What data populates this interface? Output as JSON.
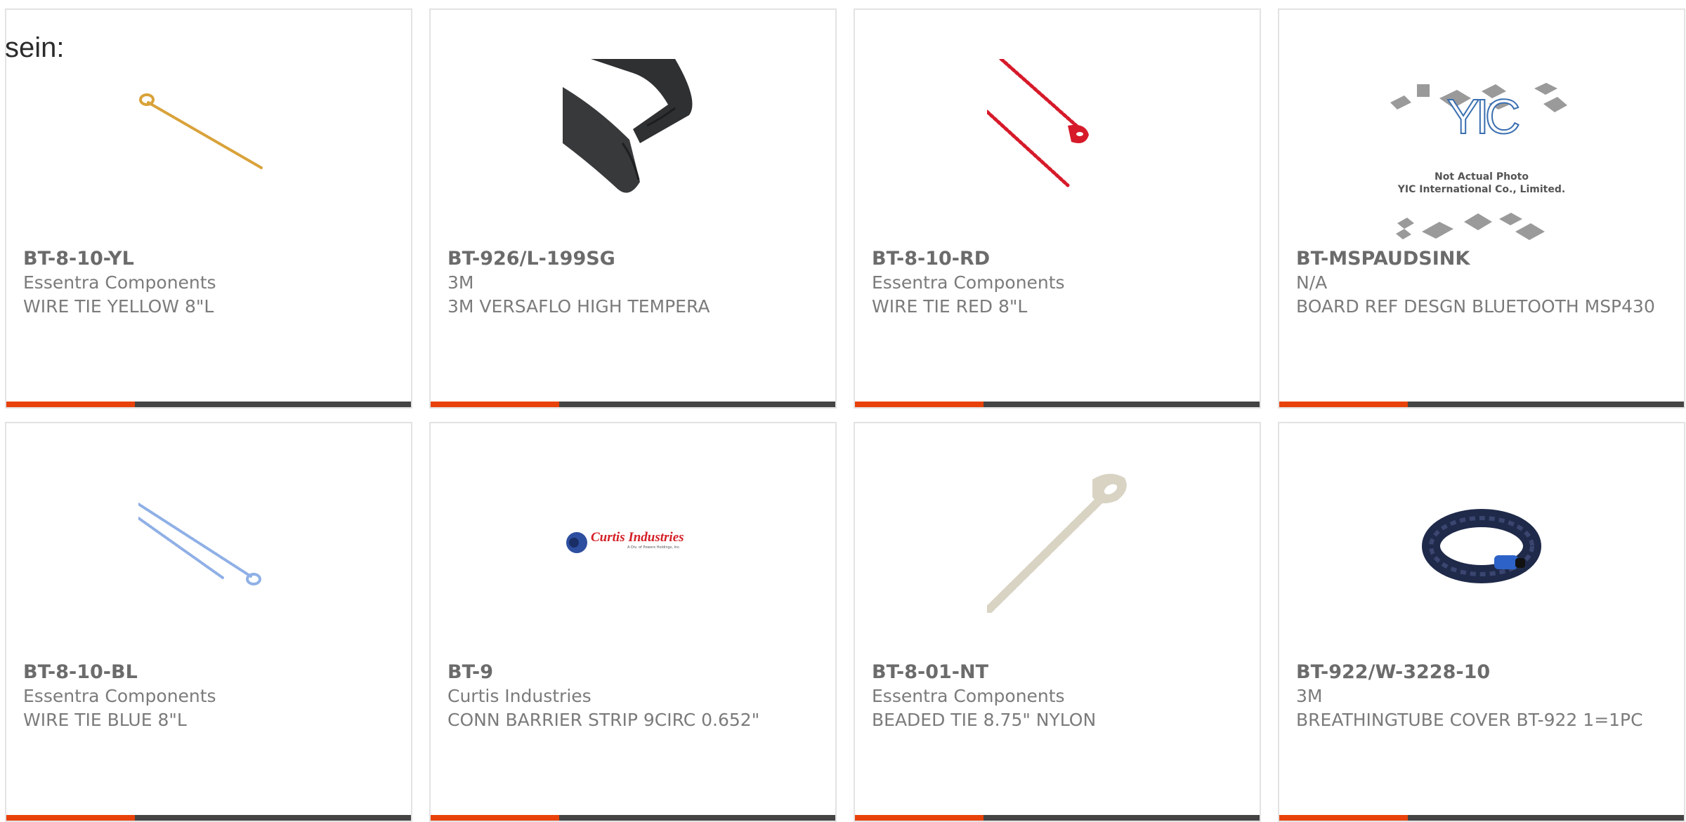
{
  "page": {
    "heading": "sein:"
  },
  "theme": {
    "accent": "#e8420a",
    "bar": "#444444",
    "border": "#e3e3e3",
    "text": "#7b7b7b"
  },
  "products": [
    {
      "part_number": "BT-8-10-YL",
      "manufacturer": "Essentra Components",
      "description": "WIRE TIE YELLOW 8\"L",
      "thumbnail": "yellow-wire-tie"
    },
    {
      "part_number": "BT-926/L-199SG",
      "manufacturer": "3M",
      "description": "3M VERSAFLO HIGH TEMPERA",
      "thumbnail": "black-sleeve-cover"
    },
    {
      "part_number": "BT-8-10-RD",
      "manufacturer": "Essentra Components",
      "description": "WIRE TIE RED 8\"L",
      "thumbnail": "red-wire-tie"
    },
    {
      "part_number": "BT-MSPAUDSINK",
      "manufacturer": "N/A",
      "description": "BOARD REF DESGN BLUETOOTH MSP430",
      "thumbnail": "not-actual-photo-placeholder",
      "placeholder_line1": "Not Actual Photo",
      "placeholder_line2": "YIC International Co., Limited.",
      "placeholder_logo": "YIC"
    },
    {
      "part_number": "BT-8-10-BL",
      "manufacturer": "Essentra Components",
      "description": "WIRE TIE BLUE 8\"L",
      "thumbnail": "blue-wire-tie"
    },
    {
      "part_number": "BT-9",
      "manufacturer": "Curtis Industries",
      "description": "CONN BARRIER STRIP 9CIRC 0.652\"",
      "thumbnail": "curtis-industries-logo",
      "logo_text": "Curtis Industries",
      "logo_subtext": "A Div. of Powers Holdings, Inc."
    },
    {
      "part_number": "BT-8-01-NT",
      "manufacturer": "Essentra Components",
      "description": "BEADED TIE 8.75\" NYLON",
      "thumbnail": "natural-beaded-tie"
    },
    {
      "part_number": "BT-922/W-3228-10",
      "manufacturer": "3M",
      "description": "BREATHINGTUBE COVER BT-922 1=1PC",
      "thumbnail": "breathing-tube-cover"
    }
  ]
}
